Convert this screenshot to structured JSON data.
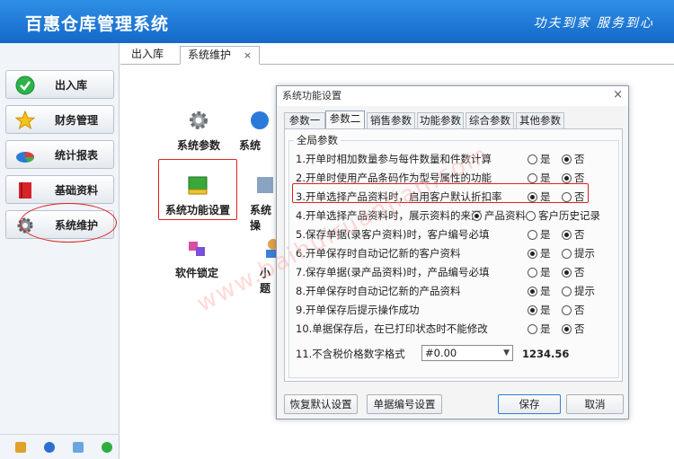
{
  "header": {
    "title": "百惠仓库管理系统",
    "slogan": "功夫到家 服务到心"
  },
  "sidebar": {
    "items": [
      {
        "label": "出入库",
        "icon": "check-circle-icon"
      },
      {
        "label": "财务管理",
        "icon": "star-icon"
      },
      {
        "label": "统计报表",
        "icon": "pie-chart-icon"
      },
      {
        "label": "基础资料",
        "icon": "book-icon"
      },
      {
        "label": "系统维护",
        "icon": "gear-icon"
      }
    ]
  },
  "tabs": [
    {
      "label": "出入库"
    },
    {
      "label": "系统维护",
      "close": "×"
    }
  ],
  "launchers": [
    {
      "label": "系统参数",
      "icon": "gear-icon"
    },
    {
      "label": "系统",
      "icon": "globe-icon"
    },
    {
      "label": "系统功能设置",
      "icon": "app-window-icon"
    },
    {
      "label": "系统操",
      "icon": "settings-icon"
    },
    {
      "label": "软件锁定",
      "icon": "lock-apps-icon"
    },
    {
      "label": "小题",
      "icon": "user-icon"
    }
  ],
  "watermark": "www.baihuiruanjian.com",
  "dialog": {
    "title": "系统功能设置",
    "close": "×",
    "tabs": [
      "参数一",
      "参数二",
      "销售参数",
      "功能参数",
      "综合参数",
      "其他参数"
    ],
    "active_tab": "参数二",
    "group_title": "全局参数",
    "rows": [
      {
        "label": "1.开单时相加数量参与每件数量和件数计算",
        "opt1": "是",
        "opt2": "否",
        "selected": 2
      },
      {
        "label": "2.开单时使用产品条码作为型号属性的功能",
        "opt1": "是",
        "opt2": "否",
        "selected": 2
      },
      {
        "label": "3.开单选择产品资料时，启用客户默认折扣率",
        "opt1": "是",
        "opt2": "否",
        "selected": 1
      },
      {
        "label": "4.开单选择产品资料时，展示资料的来源",
        "opt1": "产品资料",
        "opt2": "客户历史记录",
        "selected": 1
      },
      {
        "label": "5.保存单据(录客户资料)时，客户编号必填",
        "opt1": "是",
        "opt2": "否",
        "selected": 2
      },
      {
        "label": "6.开单保存时自动记忆新的客户资料",
        "opt1": "是",
        "opt2": "提示",
        "selected": 1
      },
      {
        "label": "7.保存单据(录产品资料)时，产品编号必填",
        "opt1": "是",
        "opt2": "否",
        "selected": 2
      },
      {
        "label": "8.开单保存时自动记忆新的产品资料",
        "opt1": "是",
        "opt2": "提示",
        "selected": 1
      },
      {
        "label": "9.开单保存后提示操作成功",
        "opt1": "是",
        "opt2": "否",
        "selected": 1
      },
      {
        "label": "10.单据保存后，在已打印状态时不能修改",
        "opt1": "是",
        "opt2": "否",
        "selected": 2
      }
    ],
    "format_row": {
      "label": "11.不含税价格数字格式",
      "value": "#0.00",
      "sample": "1234.56"
    },
    "buttons": {
      "reset": "恢复默认设置",
      "numbering": "单据编号设置",
      "save": "保存",
      "cancel": "取消"
    }
  }
}
